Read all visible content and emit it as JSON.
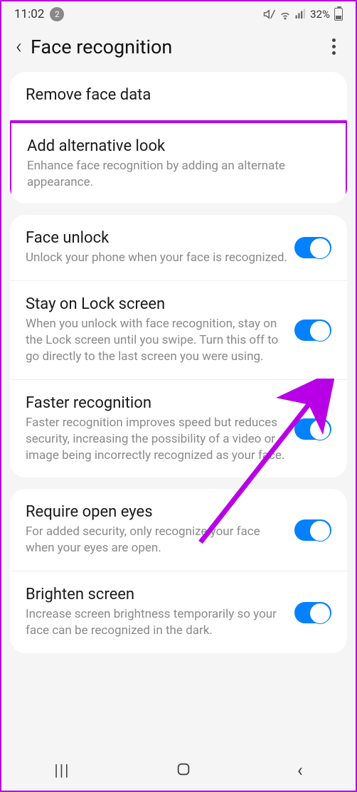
{
  "status": {
    "time": "11:02",
    "notif_count": "2",
    "battery": "32%"
  },
  "header": {
    "title": "Face recognition"
  },
  "card1": {
    "remove": {
      "title": "Remove face data"
    },
    "alt": {
      "title": "Add alternative look",
      "desc": "Enhance face recognition by adding an alternate appearance."
    }
  },
  "card2": {
    "unlock": {
      "title": "Face unlock",
      "desc": "Unlock your phone when your face is recognized."
    },
    "stay": {
      "title": "Stay on Lock screen",
      "desc": "When you unlock with face recognition, stay on the Lock screen until you swipe. Turn this off to go directly to the last screen you were using."
    },
    "faster": {
      "title": "Faster recognition",
      "desc": "Faster recognition improves speed but reduces security, increasing the possibility of a video or image being incorrectly recognized as your face."
    }
  },
  "card3": {
    "eyes": {
      "title": "Require open eyes",
      "desc": "For added security, only recognize your face when your eyes are open."
    },
    "brighten": {
      "title": "Brighten screen",
      "desc": "Increase screen brightness temporarily so your face can be recognized in the dark."
    }
  }
}
